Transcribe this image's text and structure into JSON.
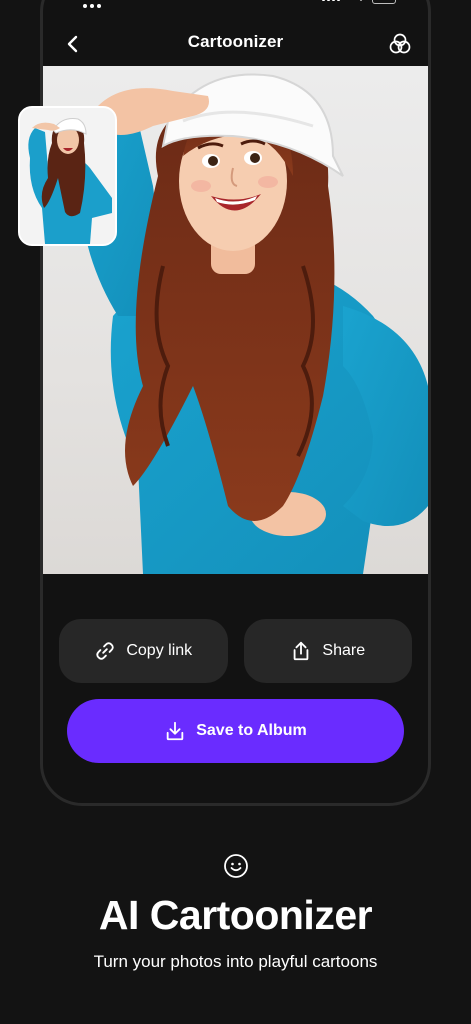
{
  "header": {
    "title": "Cartoonizer",
    "back_icon": "chevron-left-icon",
    "filters_icon": "overlapping-circles-icon"
  },
  "result_image": {
    "subject": "cartoon girl in blue long-sleeve top and white hard hat saluting"
  },
  "original_thumbnail": {
    "subject": "original photo of girl in blue top and white hard hat"
  },
  "actions": {
    "copy_link_label": "Copy link",
    "copy_link_icon": "link-icon",
    "share_label": "Share",
    "share_icon": "share-icon",
    "save_label": "Save to Album",
    "save_icon": "download-icon"
  },
  "marketing": {
    "icon": "smile-icon",
    "title": "AI Cartoonizer",
    "subtitle": "Turn your photos into playful cartoons"
  },
  "colors": {
    "background": "#131313",
    "pill": "#272727",
    "accent": "#6a2cff",
    "text": "#ffffff"
  }
}
